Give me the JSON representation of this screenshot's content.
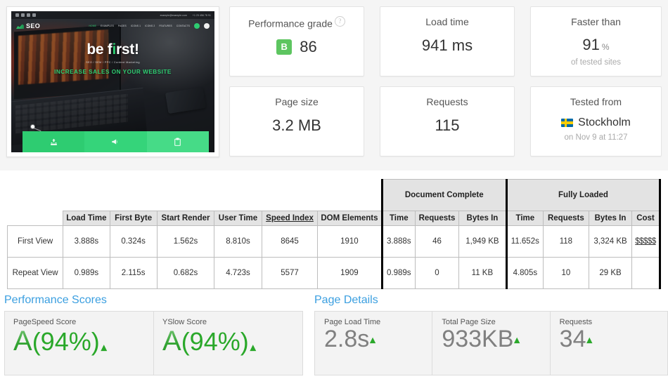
{
  "thumbnail": {
    "topbar": {
      "email": "example@example.com",
      "phone": "+1 23 456 78 91"
    },
    "logo_text": "SEO",
    "nav_items": [
      "HOME",
      "EXAMPLES",
      "PAGES",
      "ICONS 1",
      "ICONS 2",
      "FEATURES",
      "CONTACTS"
    ],
    "hero_heading": "be first!",
    "hero_sub": "SEO / SEM / PPC / Content Marketing",
    "hero_cta": "INCREASE SALES ON YOUR WEBSITE",
    "panel_icons": [
      "download-icon",
      "megaphone-icon",
      "clipboard-icon"
    ]
  },
  "cards": {
    "performance_grade": {
      "title": "Performance grade",
      "help_icon": "question-mark-icon",
      "grade_letter": "B",
      "grade_value": "86",
      "grade_color": "#5dc560"
    },
    "load_time": {
      "title": "Load time",
      "value": "941 ms"
    },
    "faster_than": {
      "title": "Faster than",
      "value": "91",
      "unit": "%",
      "note": "of tested sites"
    },
    "page_size": {
      "title": "Page size",
      "value": "3.2 MB"
    },
    "requests": {
      "title": "Requests",
      "value": "115"
    },
    "tested_from": {
      "title": "Tested from",
      "flag_icon": "sweden-flag-icon",
      "city": "Stockholm",
      "note": "on Nov 9 at 11:27"
    }
  },
  "table": {
    "group_headers": [
      {
        "label": "Document Complete",
        "span": 3
      },
      {
        "label": "Fully Loaded",
        "span": 3
      }
    ],
    "columns": [
      "Load Time",
      "First Byte",
      "Start Render",
      "User Time",
      "Speed Index",
      "DOM Elements",
      "Time",
      "Requests",
      "Bytes In",
      "Time",
      "Requests",
      "Bytes In",
      "Cost"
    ],
    "underlined_columns": [
      "Speed Index"
    ],
    "rows": [
      {
        "label": "First View",
        "cells": [
          "3.888s",
          "0.324s",
          "1.562s",
          "8.810s",
          "8645",
          "1910",
          "3.888s",
          "46",
          "1,949 KB",
          "11.652s",
          "118",
          "3,324 KB",
          "$$$$$"
        ]
      },
      {
        "label": "Repeat View",
        "cells": [
          "0.989s",
          "2.115s",
          "0.682s",
          "4.723s",
          "5577",
          "1909",
          "0.989s",
          "0",
          "11 KB",
          "4.805s",
          "10",
          "29 KB",
          ""
        ]
      }
    ]
  },
  "performance_scores": {
    "section_title": "Performance Scores",
    "items": [
      {
        "label": "PageSpeed Score",
        "grade": "A",
        "percent": "(94%)",
        "trend_icon": "caret-up-icon"
      },
      {
        "label": "YSlow Score",
        "grade": "A",
        "percent": "(94%)",
        "trend_icon": "caret-up-icon"
      }
    ]
  },
  "page_details": {
    "section_title": "Page Details",
    "items": [
      {
        "label": "Page Load Time",
        "value": "2.8s",
        "trend_icon": "caret-up-icon"
      },
      {
        "label": "Total Page Size",
        "value": "933KB",
        "trend_icon": "caret-up-icon"
      },
      {
        "label": "Requests",
        "value": "34",
        "trend_icon": "caret-up-icon"
      }
    ]
  }
}
